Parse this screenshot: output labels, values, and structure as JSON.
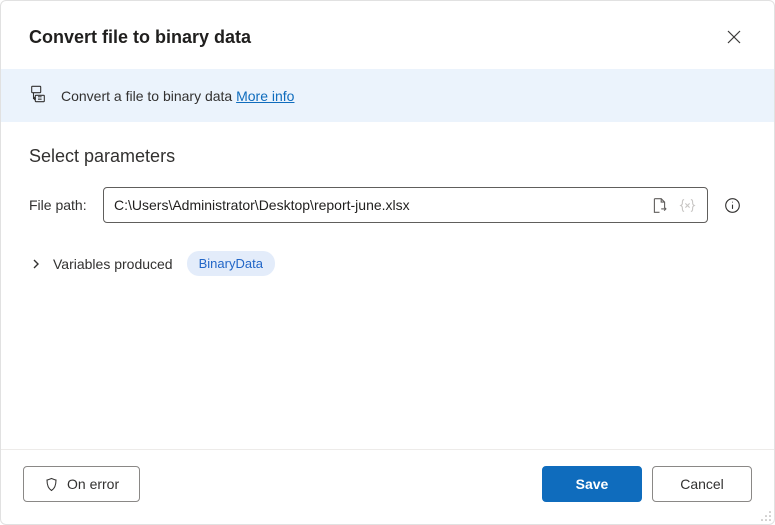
{
  "header": {
    "title": "Convert file to binary data"
  },
  "banner": {
    "text": "Convert a file to binary data ",
    "link": "More info"
  },
  "params": {
    "section_title": "Select parameters",
    "file_path_label": "File path:",
    "file_path_value": "C:\\Users\\Administrator\\Desktop\\report-june.xlsx"
  },
  "variables": {
    "label": "Variables produced",
    "chip": "BinaryData"
  },
  "footer": {
    "on_error": "On error",
    "save": "Save",
    "cancel": "Cancel"
  }
}
